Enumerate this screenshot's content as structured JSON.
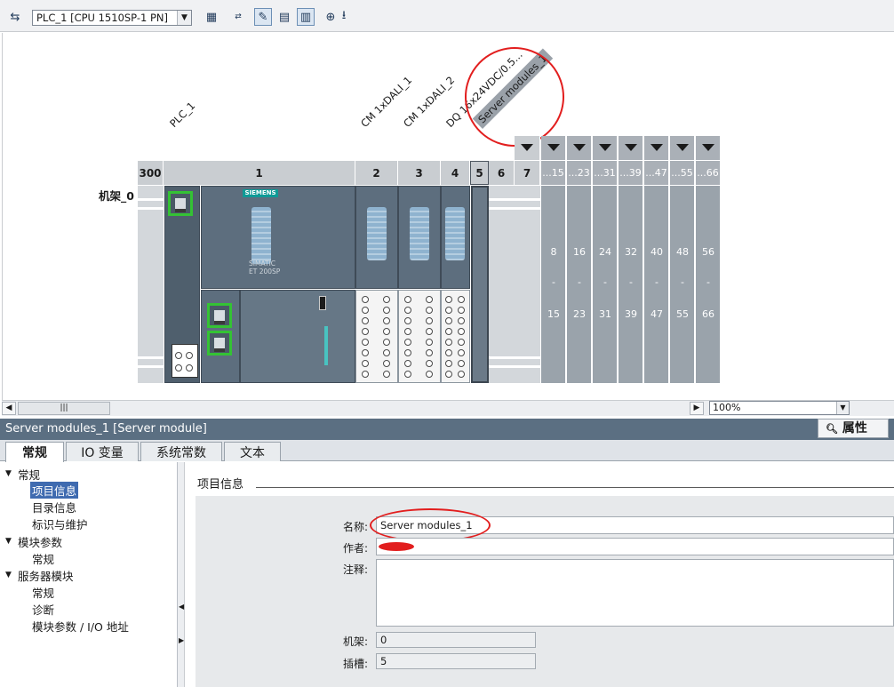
{
  "toolbar": {
    "device": "PLC_1 [CPU 1510SP-1 PN]",
    "icons": [
      "network-icon",
      "device-view-icon",
      "ip-address-icon",
      "edit-icon",
      "grid-icon",
      "overview-icon",
      "zoom-in-icon",
      "download-icon"
    ]
  },
  "rack": {
    "label": "机架_0",
    "module_labels": [
      "PLC_1",
      "CM 1xDALI_1",
      "CM 1xDALI_2",
      "DQ 16x24VDC/0.5...",
      "Server modules_1"
    ],
    "slots": [
      "300",
      "1",
      "2",
      "3",
      "4",
      "5",
      "6",
      "7"
    ],
    "address_ranges": [
      {
        "tab": "...15",
        "start": "8",
        "end": "15"
      },
      {
        "tab": "...23",
        "start": "16",
        "end": "23"
      },
      {
        "tab": "...31",
        "start": "24",
        "end": "31"
      },
      {
        "tab": "...39",
        "start": "32",
        "end": "39"
      },
      {
        "tab": "...47",
        "start": "40",
        "end": "47"
      },
      {
        "tab": "...55",
        "start": "48",
        "end": "55"
      },
      {
        "tab": "...66",
        "start": "56",
        "end": "66"
      }
    ],
    "range_separator": "-",
    "cpu_brand": "SIEMENS",
    "cpu_model_line1": "SIMATIC",
    "cpu_model_line2": "ET 200SP"
  },
  "zoom": "100%",
  "inspector": {
    "title": "Server modules_1 [Server module]",
    "properties_tab": "属性",
    "tabs": [
      "常规",
      "IO 变量",
      "系统常数",
      "文本"
    ],
    "tree": [
      {
        "label": "常规",
        "level": 0
      },
      {
        "label": "项目信息",
        "level": 1,
        "selected": true
      },
      {
        "label": "目录信息",
        "level": 1
      },
      {
        "label": "标识与维护",
        "level": 1
      },
      {
        "label": "模块参数",
        "level": 0
      },
      {
        "label": "常规",
        "level": 1
      },
      {
        "label": "服务器模块",
        "level": 0
      },
      {
        "label": "常规",
        "level": 1
      },
      {
        "label": "诊断",
        "level": 1
      },
      {
        "label": "模块参数 / I/O 地址",
        "level": 1
      }
    ],
    "section_title": "项目信息",
    "fields": {
      "name_label": "名称:",
      "name_value": "Server modules_1",
      "author_label": "作者:",
      "author_value": "",
      "comment_label": "注释:",
      "comment_value": "",
      "rack_label": "机架:",
      "rack_value": "0",
      "slot_label": "插槽:",
      "slot_value": "5"
    }
  }
}
